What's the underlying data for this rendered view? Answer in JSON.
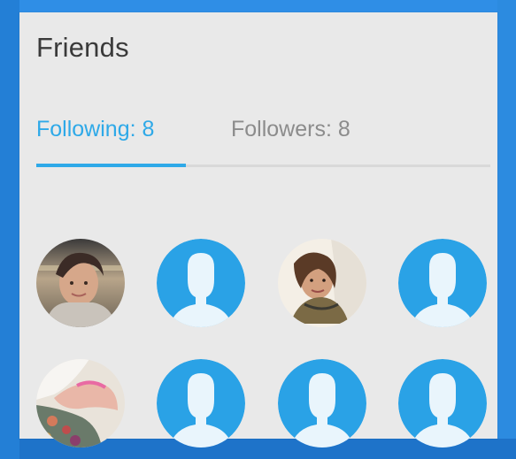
{
  "friends": {
    "title": "Friends",
    "tabs": [
      {
        "label": "Following: 8",
        "active": true
      },
      {
        "label": "Followers: 8",
        "active": false
      }
    ],
    "colors": {
      "accent": "#2ea9e8",
      "placeholder_bg": "#2aa2e6"
    },
    "avatars": [
      {
        "type": "photo",
        "icon": "user-photo-avatar"
      },
      {
        "type": "placeholder",
        "icon": "default-user-icon"
      },
      {
        "type": "photo",
        "icon": "user-photo-avatar"
      },
      {
        "type": "placeholder",
        "icon": "default-user-icon"
      },
      {
        "type": "photo",
        "icon": "user-photo-avatar"
      },
      {
        "type": "placeholder",
        "icon": "default-user-icon"
      },
      {
        "type": "placeholder",
        "icon": "default-user-icon"
      },
      {
        "type": "placeholder",
        "icon": "default-user-icon"
      }
    ]
  }
}
